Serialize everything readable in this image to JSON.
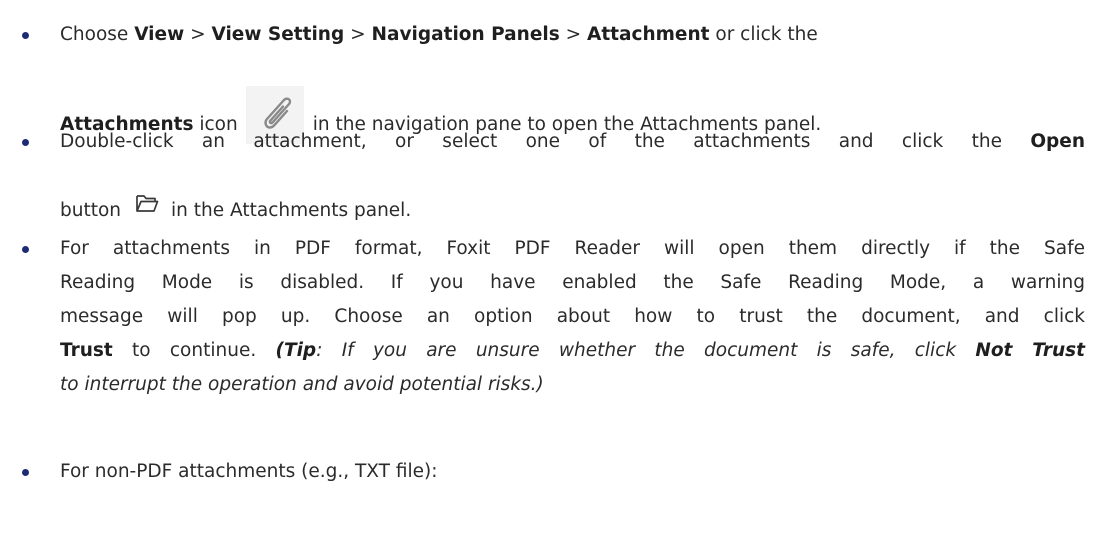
{
  "step1": {
    "l1_a": "Choose ",
    "view": "View",
    "sep": ">",
    "view_setting": "View Setting",
    "navigation_panels": "Navigation Panels",
    "attachment": "Attachment",
    "l1_b": "or click the",
    "attachments_bold": "Attachments",
    "icon_word": "icon",
    "l2_b": "in the navigation pane to open the Attachments panel.",
    "icon": "paperclip-icon"
  },
  "step2": {
    "l1_a": "Double-click an attachment, or select one of the attachments and click the",
    "open": "Open",
    "button_word": "button",
    "l2_b": "in the Attachments panel.",
    "icon": "folder-open-icon"
  },
  "step3": {
    "l1": "For attachments in PDF format, Foxit PDF Reader will open them directly if the Safe",
    "l2": "Reading Mode is disabled. If you have enabled the Safe Reading Mode, a warning",
    "l3": "message will pop up. Choose an option about how to trust the document, and click",
    "trust": "Trust",
    "l4_a": "to continue.",
    "tip_open": "(",
    "tip_label": "Tip",
    "tip_text": ": If you are unsure whether the document is safe, click",
    "not_trust": "Not Trust",
    "l5": "to interrupt the operation and avoid potential risks.)"
  },
  "step4": {
    "l1": "For non-PDF attachments (e.g., TXT file):"
  },
  "colors": {
    "bullet": "#1c2b75",
    "text": "#2b2b2b",
    "icon_bg": "#f3f3f3"
  }
}
